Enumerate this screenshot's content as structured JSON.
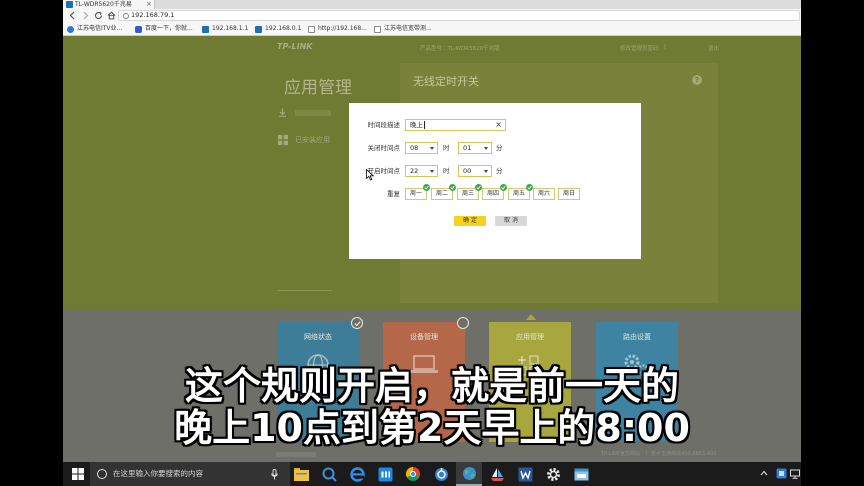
{
  "browser": {
    "tab": {
      "title": "TL-WDR5620千兆易",
      "close": "×"
    },
    "address": "192.168.79.1",
    "bookmarks": [
      {
        "label": "江苏电信ITV业...",
        "icon": "ie-favicon-icon"
      },
      {
        "label": "百度一下，你就...",
        "icon": "baidu-favicon-icon"
      },
      {
        "label": "192.168.1.1",
        "icon": "router-favicon-icon"
      },
      {
        "label": "192.168.0.1",
        "icon": "router-favicon-icon"
      },
      {
        "label": "http://192.168...",
        "icon": "page-favicon-icon"
      },
      {
        "label": "江苏电信宽带测...",
        "icon": "page-favicon-icon"
      }
    ]
  },
  "page": {
    "header": {
      "logo": "TP-LINK",
      "model": "产品型号：TL-WDR5620千兆版",
      "change_password": "修改管理员密码",
      "separator": "|",
      "logout": "退出"
    },
    "sidebar": {
      "title": "应用管理",
      "items": [
        {
          "label": "已安装应用",
          "icon": "grid-icon"
        }
      ]
    },
    "content_title": "无线定时开关",
    "help": "?",
    "cards": [
      {
        "label": "网络状态",
        "color": "#3e7d98",
        "icon": "globe-icon"
      },
      {
        "label": "设备管理",
        "color": "#b5674a",
        "icon": "laptop-icon"
      },
      {
        "label": "应用管理",
        "color": "#a8a63e",
        "icon": "apps-icon"
      },
      {
        "label": "路由设置",
        "color": "#3e84a2",
        "icon": "gears-icon"
      }
    ],
    "footer": {
      "website": "TP-LINK官方网站",
      "separator": "|",
      "hotline": "技术支持热线400-8863-400"
    }
  },
  "modal": {
    "description": {
      "label": "时间段描述",
      "value": "晚上",
      "clear": "×"
    },
    "off_time": {
      "label": "关闭时间点",
      "hour": "08",
      "hour_unit": "时",
      "minute": "01",
      "minute_unit": "分"
    },
    "on_time": {
      "label": "开启时间点",
      "hour": "22",
      "hour_unit": "时",
      "minute": "00",
      "minute_unit": "分"
    },
    "repeat": {
      "label": "重复",
      "days": [
        {
          "label": "周一",
          "checked": true
        },
        {
          "label": "周二",
          "checked": true
        },
        {
          "label": "周三",
          "checked": true
        },
        {
          "label": "周四",
          "checked": true
        },
        {
          "label": "周五",
          "checked": true
        },
        {
          "label": "周六",
          "checked": false
        },
        {
          "label": "周日",
          "checked": false
        }
      ]
    },
    "confirm": "确 定",
    "cancel": "取 消"
  },
  "subtitles": {
    "line1": "这个规则开启，就是前一天的",
    "line2": "晚上10点到第2天早上的8:00"
  },
  "taskbar": {
    "search_placeholder": "在这里输入你要搜索的内容",
    "apps": [
      {
        "icon": "file-explorer-icon"
      },
      {
        "icon": "search-app-icon"
      },
      {
        "icon": "ie-browser-icon"
      },
      {
        "icon": "blue-square-app-icon"
      },
      {
        "icon": "chrome-icon"
      },
      {
        "icon": "blue-circle-app-icon"
      },
      {
        "icon": "globe-browser-icon",
        "active": true
      },
      {
        "icon": "ship-app-icon"
      },
      {
        "icon": "word-icon"
      },
      {
        "icon": "settings-gear-icon"
      },
      {
        "icon": "window-app-icon"
      }
    ],
    "tray": [
      {
        "icon": "chevron-up-icon"
      },
      {
        "icon": "tray-app-icon"
      },
      {
        "icon": "display-tray-icon"
      }
    ]
  },
  "colors": {
    "page_overlay": "#6f7a33",
    "lower_band": "#6f6f6a",
    "field_border": "#e0c352",
    "confirm_bg": "#f7d21c",
    "cancel_bg": "#d8d8d8",
    "check_green": "#3caa47",
    "taskbar_bg": "#1b1b1b"
  }
}
